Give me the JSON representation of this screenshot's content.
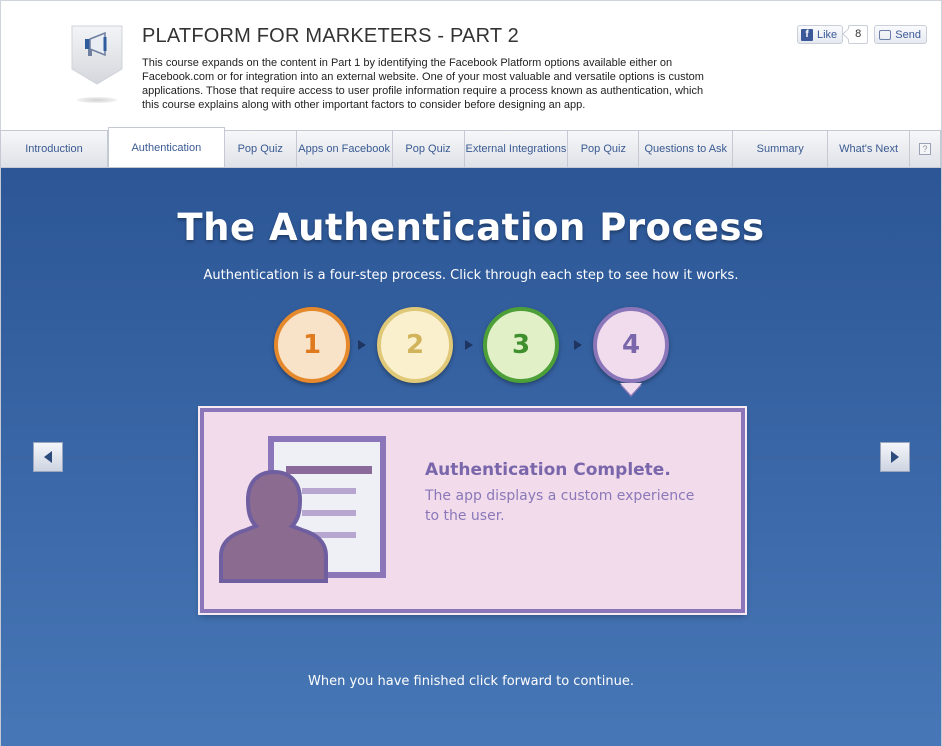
{
  "header": {
    "title": "PLATFORM FOR MARKETERS - PART 2",
    "description": "This course expands on the content in Part 1 by identifying the Facebook Platform options available either on Facebook.com or for integration into an external website. One of your most valuable and versatile options is custom applications. Those that require access to user profile information require a process known as authentication, which this course explains along with other important factors to consider before designing an app.",
    "badge_icon": "megaphone-icon"
  },
  "social": {
    "like_label": "Like",
    "like_count": "8",
    "send_label": "Send"
  },
  "tabs": [
    {
      "label": "Introduction",
      "active": false
    },
    {
      "label": "Authentication",
      "active": true
    },
    {
      "label": "Pop Quiz",
      "active": false
    },
    {
      "label": "Apps on Facebook",
      "active": false
    },
    {
      "label": "Pop Quiz",
      "active": false
    },
    {
      "label": "External Integrations",
      "active": false
    },
    {
      "label": "Pop Quiz",
      "active": false
    },
    {
      "label": "Questions to Ask",
      "active": false
    },
    {
      "label": "Summary",
      "active": false
    },
    {
      "label": "What's Next",
      "active": false
    }
  ],
  "help_label": "?",
  "main": {
    "heading": "The Authentication Process",
    "subheading": "Authentication is a four-step process. Click through each step to see how it works.",
    "steps": [
      {
        "label": "1",
        "color": "#e5892c"
      },
      {
        "label": "2",
        "color": "#dfc877"
      },
      {
        "label": "3",
        "color": "#4d9f3a"
      },
      {
        "label": "4",
        "color": "#8a76b8",
        "selected": true
      }
    ],
    "panel": {
      "title": "Authentication Complete.",
      "text": "The app displays a custom experience to the user.",
      "illustration": "user-profile-icon"
    },
    "footer": "When you have finished click forward to continue."
  },
  "colors": {
    "main_bg_top": "#2c5696",
    "main_bg_bottom": "#4777b6",
    "accent_purple": "#8a76b8",
    "panel_bg": "#f2dcec"
  }
}
